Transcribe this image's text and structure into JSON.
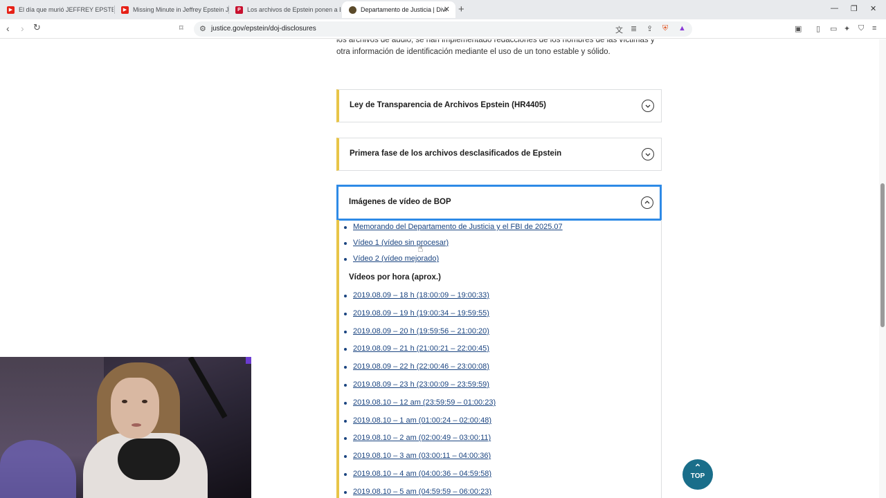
{
  "browser": {
    "tabs": [
      {
        "title": "El día que murió JEFFREY EPSTEIN - T",
        "favicon": "youtube"
      },
      {
        "title": "Missing Minute in Jeffrey Epstein Jail",
        "favicon": "youtube"
      },
      {
        "title": "Los archivos de Epstein ponen a Bill",
        "favicon": "p-site"
      },
      {
        "title": "Departamento de Justicia | Divul",
        "favicon": "doj-seal",
        "active": true
      }
    ],
    "url": "justice.gov/epstein/doj-disclosures"
  },
  "page": {
    "intro_text": "los archivos de audio, se han implementado redacciones de los nombres de las víctimas y otra información de identificación mediante el uso de un tono estable y sólido.",
    "accordions": [
      {
        "title": "Ley de Transparencia de Archivos Epstein (HR4405)",
        "expanded": false
      },
      {
        "title": "Primera fase de los archivos desclasificados de Epstein",
        "expanded": false
      },
      {
        "title": "Imágenes de vídeo de BOP",
        "expanded": true
      }
    ],
    "bop_links": [
      "Memorando del Departamento de Justicia y el FBI de 2025.07",
      "Vídeo 1 (vídeo sin procesar)",
      "Vídeo 2 (vídeo mejorado)"
    ],
    "hourly_heading": "Vídeos por hora (aprox.)",
    "hourly_links": [
      "2019.08.09 – 18 h (18:00:09 – 19:00:33)",
      "2019.08.09 – 19 h (19:00:34 – 19:59:55)",
      "2019.08.09 – 20 h (19:59:56 – 21:00:20)",
      "2019.08.09 – 21 h (21:00:21 – 22:00:45)",
      "2019.08.09 – 22 h (22:00:46 – 23:00:08)",
      "2019.08.09 – 23 h (23:00:09 – 23:59:59)",
      "2019.08.10 – 12 am (23:59:59 – 01:00:23)",
      "2019.08.10 – 1 am (01:00:24 – 02:00:48)",
      "2019.08.10 – 2 am (02:00:49 – 03:00:11)",
      "2019.08.10 – 3 am (03:00:11 – 04:00:36)",
      "2019.08.10 – 4 am (04:00:36 – 04:59:58)",
      "2019.08.10 – 5 am (04:59:59 – 06:00:23)"
    ],
    "top_button": "TOP"
  },
  "colors": {
    "accent_gold": "#e8c548",
    "link_blue": "#1a4480",
    "focus_blue": "#2e8ae6",
    "top_button_bg": "#1a6e8a"
  }
}
